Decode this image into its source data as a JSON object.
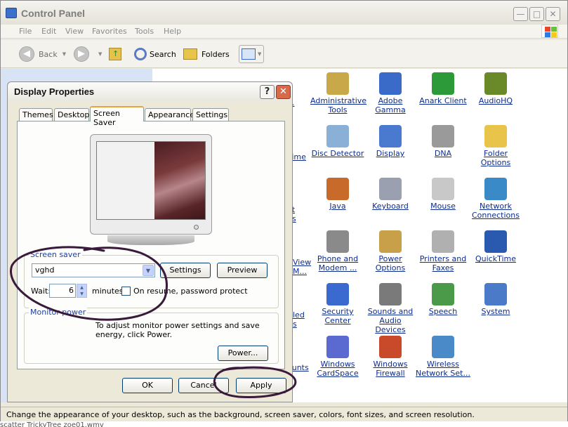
{
  "window": {
    "title": "Control Panel",
    "controls": {
      "minimize": "—",
      "maximize": "□",
      "close": "✕"
    }
  },
  "menu": [
    "File",
    "Edit",
    "View",
    "Favorites",
    "Tools",
    "Help"
  ],
  "toolbar": {
    "back_label": "Back",
    "forward_label": "",
    "search_label": "Search",
    "folders_label": "Folders"
  },
  "items": [
    {
      "label": "Administrative Tools",
      "icon": "admin-tools-icon",
      "color": "#c9a84a"
    },
    {
      "label": "Adobe Gamma",
      "icon": "monitor-icon",
      "color": "#3a6bc8"
    },
    {
      "label": "Anark Client",
      "icon": "cube-icon",
      "color": "#2d9a3a"
    },
    {
      "label": "AudioHQ",
      "icon": "audio-icon",
      "color": "#6a8a2a"
    },
    {
      "label": "Time",
      "icon": "",
      "color": ""
    },
    {
      "label": "Disc Detector",
      "icon": "disc-icon",
      "color": "#8ab0d8"
    },
    {
      "label": "Display",
      "icon": "display-icon",
      "color": "#4a7ad0"
    },
    {
      "label": "DNA",
      "icon": "dna-icon",
      "color": "#9a9a9a"
    },
    {
      "label": "Folder Options",
      "icon": "folder-icon",
      "color": "#e8c44a"
    },
    {
      "label": "Java",
      "icon": "java-icon",
      "color": "#c86a2a"
    },
    {
      "label": "Keyboard",
      "icon": "keyboard-icon",
      "color": "#9aa0b0"
    },
    {
      "label": "Mouse",
      "icon": "mouse-icon",
      "color": "#c8c8c8"
    },
    {
      "label": "Network Connections",
      "icon": "network-icon",
      "color": "#3a8ac8"
    },
    {
      "label": "Phone and Modem ...",
      "icon": "phone-icon",
      "color": "#8a8a8a"
    },
    {
      "label": "Power Options",
      "icon": "power-icon",
      "color": "#c8a04a"
    },
    {
      "label": "Printers and Faxes",
      "icon": "printer-icon",
      "color": "#b0b0b0"
    },
    {
      "label": "QuickTime",
      "icon": "quicktime-icon",
      "color": "#2a5ab0"
    },
    {
      "label": "Security Center",
      "icon": "shield-icon",
      "color": "#3a6ad0"
    },
    {
      "label": "Sounds and Audio Devices",
      "icon": "speaker-icon",
      "color": "#7a7a7a"
    },
    {
      "label": "Speech",
      "icon": "speech-icon",
      "color": "#4a9a4a"
    },
    {
      "label": "System",
      "icon": "system-icon",
      "color": "#4a7ac8"
    },
    {
      "label": "Windows CardSpace",
      "icon": "cardspace-icon",
      "color": "#5a6ad0"
    },
    {
      "label": "Windows Firewall",
      "icon": "firewall-icon",
      "color": "#c84a2a"
    },
    {
      "label": "Wireless Network Set...",
      "icon": "wireless-icon",
      "color": "#4a8ac8"
    }
  ],
  "partial_labels": [
    "r",
    "...",
    "et",
    "ns",
    "View",
    "M...",
    "led",
    "s",
    "ounts"
  ],
  "status": "Change the appearance of your desktop, such as the background, screen saver, colors, font sizes, and screen resolution.",
  "taskbar_fragment": "scatter   TrickyTree   zoe01.wmv",
  "dialog": {
    "title": "Display Properties",
    "help": "?",
    "close": "✕",
    "tabs": [
      "Themes",
      "Desktop",
      "Screen Saver",
      "Appearance",
      "Settings"
    ],
    "active_tab": "Screen Saver",
    "screen_saver": {
      "group_label": "Screen saver",
      "selected": "vghd",
      "settings_button": "Settings",
      "preview_button": "Preview",
      "wait_label": "Wait:",
      "wait_value": "6",
      "minutes_label": "minutes",
      "resume_label": "On resume, password protect",
      "resume_checked": false
    },
    "monitor_power": {
      "group_label": "Monitor power",
      "text": "To adjust monitor power settings and save energy, click Power.",
      "power_button": "Power..."
    },
    "buttons": {
      "ok": "OK",
      "cancel": "Cancel",
      "apply": "Apply"
    }
  },
  "colors": {
    "link": "#0c2c8e",
    "group_label": "#1f3f9a",
    "annotation_ink": "#3a1a3a",
    "left_pane": "#d9e3f6"
  }
}
